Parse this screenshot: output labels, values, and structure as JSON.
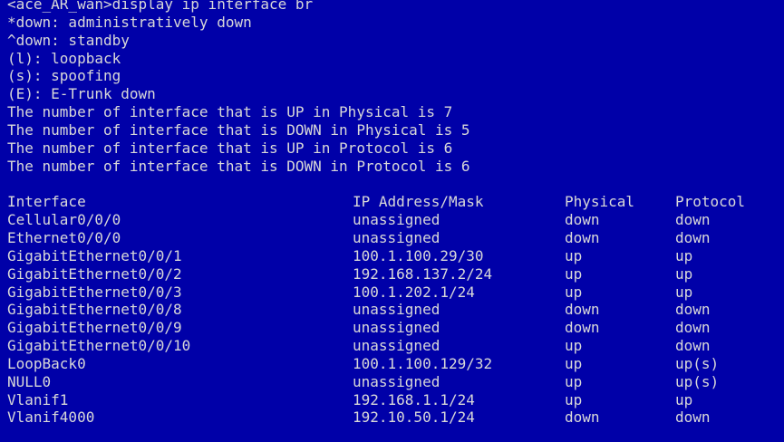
{
  "colors": {
    "background": "#0000a8",
    "text": "#d8d8d8"
  },
  "prompt_line": "<ace_AR_wan>display ip interface br",
  "legend": [
    "*down: administratively down",
    "^down: standby",
    "(l): loopback",
    "(s): spoofing",
    "(E): E-Trunk down"
  ],
  "summary": [
    "The number of interface that is UP in Physical is 7",
    "The number of interface that is DOWN in Physical is 5",
    "The number of interface that is UP in Protocol is 6",
    "The number of interface that is DOWN in Protocol is 6"
  ],
  "table": {
    "headers": [
      "Interface",
      "IP Address/Mask",
      "Physical",
      "Protocol"
    ],
    "rows": [
      [
        "Cellular0/0/0",
        "unassigned",
        "down",
        "down"
      ],
      [
        "Ethernet0/0/0",
        "unassigned",
        "down",
        "down"
      ],
      [
        "GigabitEthernet0/0/1",
        "100.1.100.29/30",
        "up",
        "up"
      ],
      [
        "GigabitEthernet0/0/2",
        "192.168.137.2/24",
        "up",
        "up"
      ],
      [
        "GigabitEthernet0/0/3",
        "100.1.202.1/24",
        "up",
        "up"
      ],
      [
        "GigabitEthernet0/0/8",
        "unassigned",
        "down",
        "down"
      ],
      [
        "GigabitEthernet0/0/9",
        "unassigned",
        "down",
        "down"
      ],
      [
        "GigabitEthernet0/0/10",
        "unassigned",
        "up",
        "down"
      ],
      [
        "LoopBack0",
        "100.1.100.129/32",
        "up",
        "up(s)"
      ],
      [
        "NULL0",
        "unassigned",
        "up",
        "up(s)"
      ],
      [
        "Vlanif1",
        "192.168.1.1/24",
        "up",
        "up"
      ],
      [
        "Vlanif4000",
        "192.10.50.1/24",
        "down",
        "down"
      ]
    ]
  }
}
